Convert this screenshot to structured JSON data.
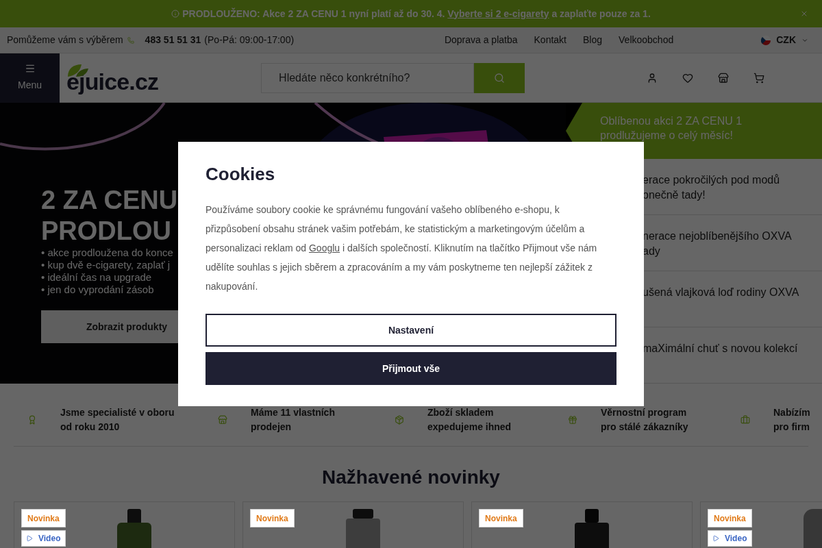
{
  "announcement": {
    "before": "PRODLOUŽENO: Akce 2 ZA CENU 1 nyní platí až do 30. 4.",
    "link": "Vyberte si 2 e-cigarety",
    "after": "a zaplaťte pouze za 1."
  },
  "topbar": {
    "help": "Pomůžeme vám s výběrem",
    "phone": "483 51 51 31",
    "hours": "(Po-Pá: 09:00-17:00)",
    "links": [
      "Doprava a platba",
      "Kontakt",
      "Blog",
      "Velkoobchod"
    ],
    "currency": "CZK"
  },
  "header": {
    "menu_label": "Menu",
    "logo": "ejuice.cz",
    "search": {
      "placeholder": "Hledáte něco konkrétního?"
    }
  },
  "hero": {
    "title_lines": [
      "2 ZA CENU",
      "PRODLOU"
    ],
    "bullets": [
      "• akce prodloužena do konce",
      "• kup dvě e-cigarety, zaplať j",
      "• ideální čas na upgrade",
      "• jen do vyprodání zásob"
    ],
    "button": "Zobrazit produkty"
  },
  "promo_list": [
    {
      "lines": [
        "Oblíbenou akci 2 ZA CENU 1",
        "prodlužujeme o celý měsíc!"
      ],
      "selected": true
    },
    {
      "lines": [
        "erace pokročilých pod modů",
        "onečně tady!"
      ],
      "selected": false
    },
    {
      "lines": [
        "nerace nejoblíbenějšího OXVA",
        "ady"
      ],
      "selected": false
    },
    {
      "lines": [
        "ušená vlajková loď rodiny OXVA"
      ],
      "selected": false
    },
    {
      "lines": [
        "maXimální chuť s novou kolekcí"
      ],
      "selected": false
    }
  ],
  "features": [
    {
      "kind": "award",
      "lines": [
        "Jsme specialisté v oboru",
        "od roku 2010"
      ]
    },
    {
      "kind": "store",
      "lines": [
        "Máme 11 vlastních",
        "prodejen"
      ]
    },
    {
      "kind": "package",
      "lines": [
        "Zboží skladem",
        "expedujeme ihned"
      ]
    },
    {
      "kind": "gift",
      "lines": [
        "Věrnostní program",
        "pro stálé zákazníky"
      ]
    },
    {
      "kind": "briefcase",
      "lines": [
        "Nabízím",
        "pro firm"
      ]
    }
  ],
  "section_title": "Nažhavené novinky",
  "products": [
    {
      "badges": [
        {
          "kind": "new",
          "label": "Novinka"
        },
        {
          "kind": "video",
          "label": "Video"
        }
      ]
    },
    {
      "badges": [
        {
          "kind": "new",
          "label": "Novinka"
        }
      ]
    },
    {
      "badges": [
        {
          "kind": "new",
          "label": "Novinka"
        }
      ]
    },
    {
      "badges": [
        {
          "kind": "new",
          "label": "Novinka"
        },
        {
          "kind": "video",
          "label": "Video"
        }
      ]
    }
  ],
  "cookies": {
    "title": "Cookies",
    "text_before": "Používáme soubory cookie ke správnému fungování vašeho oblíbeného e-shopu, k přizpůsobení obsahu stránek vašim potřebám, ke statistickým a marketingovým účelům a personalizaci reklam od",
    "link": "Googlu",
    "text_after": "i dalších společností. Kliknutím na tlačítko Přijmout vše nám udělíte souhlas s jejich sběrem a zpracováním a my vám poskytneme ten nejlepší zážitek z nakupování.",
    "buttons": [
      {
        "kind": "outline",
        "label": "Nastavení"
      },
      {
        "kind": "filled",
        "label": "Přijmout vše"
      }
    ]
  }
}
